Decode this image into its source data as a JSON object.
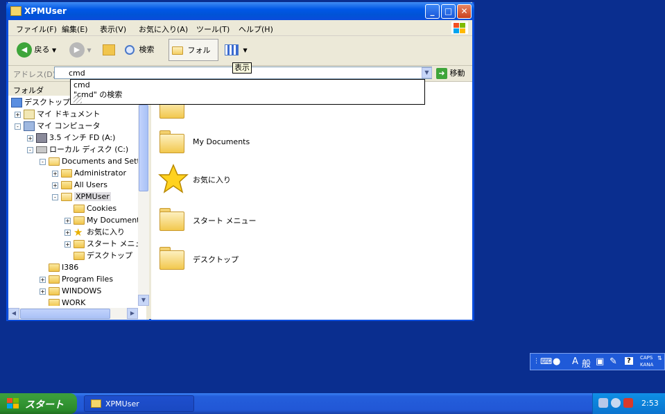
{
  "window": {
    "title": "XPMUser",
    "controls": {
      "minimize": "_",
      "maximize": "□",
      "close": "✕"
    }
  },
  "menubar": {
    "items": [
      "ファイル(F)",
      "編集(E)",
      "表示(V)",
      "お気に入り(A)",
      "ツール(T)",
      "ヘルプ(H)"
    ]
  },
  "toolbar": {
    "back_label": "戻る",
    "search_label": "検索",
    "folders_label": "フォルダ",
    "views_tooltip": "表示"
  },
  "address_bar": {
    "label": "アドレス(D)",
    "value": "cmd",
    "go_label": "移動"
  },
  "autocomplete": {
    "items": [
      "cmd",
      "\"cmd\" の検索"
    ]
  },
  "folders_pane": {
    "header": "フォルダ",
    "tree": [
      {
        "label": "デスクトップ",
        "expander": ""
      },
      {
        "label": "マイ ドキュメント",
        "expander": "+"
      },
      {
        "label": "マイ コンピュータ",
        "expander": "-"
      },
      {
        "label": "3.5 インチ FD (A:)",
        "expander": "+"
      },
      {
        "label": "ローカル ディスク (C:)",
        "expander": "-"
      },
      {
        "label": "Documents and Settings",
        "expander": "-"
      },
      {
        "label": "Administrator",
        "expander": "+"
      },
      {
        "label": "All Users",
        "expander": "+"
      },
      {
        "label": "XPMUser",
        "expander": "-"
      },
      {
        "label": "Cookies",
        "expander": ""
      },
      {
        "label": "My Documents",
        "expander": "+"
      },
      {
        "label": "お気に入り",
        "expander": "+"
      },
      {
        "label": "スタート メニュー",
        "expander": "+"
      },
      {
        "label": "デスクトップ",
        "expander": ""
      },
      {
        "label": "I386",
        "expander": ""
      },
      {
        "label": "Program Files",
        "expander": "+"
      },
      {
        "label": "WINDOWS",
        "expander": "+"
      },
      {
        "label": "WORK",
        "expander": ""
      }
    ]
  },
  "main_pane": {
    "items": [
      "My Documents",
      "お気に入り",
      "スタート メニュー",
      "デスクトップ"
    ]
  },
  "language_bar": {
    "ime_mode": "A",
    "conversion_mode": "般",
    "caps_label": "CAPS",
    "kana_label": "KANA",
    "help_label": "?"
  },
  "taskbar": {
    "start_label": "スタート",
    "task_label": "XPMUser",
    "clock": "2:53"
  },
  "colors": {
    "desktop": "#0a2e8f",
    "title_blue": "#0058e6",
    "start_green": "#3a9d3a",
    "tray_blue": "#0c8ae0"
  }
}
